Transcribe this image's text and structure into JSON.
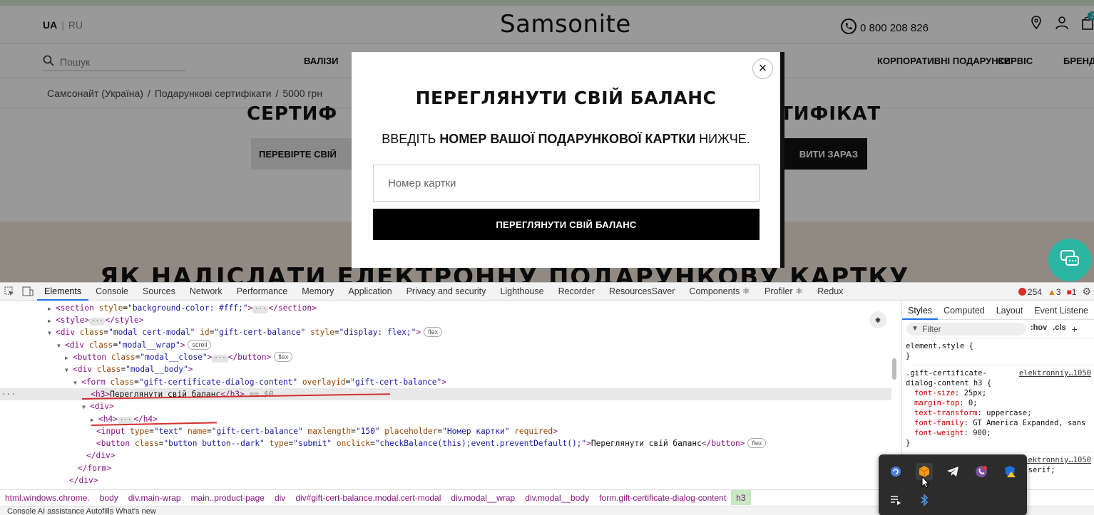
{
  "site": {
    "lang": {
      "ua": "UA",
      "ru": "RU"
    },
    "logo": "Samsonite",
    "phone": "0 800 208 826",
    "cart_count": "3",
    "search_placeholder": "Пошук",
    "nav": {
      "luggage": "ВАЛІЗИ",
      "corporate": "КОРПОРАТИВНІ ПОДАРУНКИ",
      "service": "СЕРВІС",
      "brands": "БРЕНД"
    },
    "breadcrumbs": [
      "Самсонайт (Україна)",
      "Подарункові сертифікати",
      "5000 грн"
    ],
    "title_left": "СЕРТИФ",
    "title_right": "ТИФІКАТ",
    "check_button": "ПЕРЕВІРТЕ СВІЙ",
    "buy_button": "ВИТИ ЗАРАЗ",
    "how_to_title": "ЯК НАДІСЛАТИ ЕЛЕКТРОННУ ПОДАРУНКОВУ КАРТКУ"
  },
  "modal": {
    "close": "×",
    "title": "Переглянути свій баланс",
    "sub_prefix": "ВВЕДІТЬ ",
    "sub_bold": "НОМЕР ВАШОЇ ПОДАРУНКОВОЇ КАРТКИ",
    "sub_suffix": " НИЖЧЕ.",
    "input_placeholder": "Номер картки",
    "submit": "ПЕРЕГЛЯНУТИ СВІЙ БАЛАНС"
  },
  "devtools": {
    "tabs": [
      "Elements",
      "Console",
      "Sources",
      "Network",
      "Performance",
      "Memory",
      "Application",
      "Privacy and security",
      "Lighthouse",
      "Recorder",
      "ResourcesSaver",
      "Components ⚛",
      "Profiler ⚛",
      "Redux"
    ],
    "errors": "254",
    "warnings": "3",
    "issues": "1",
    "styles_tabs": [
      "Styles",
      "Computed",
      "Layout",
      "Event Listene"
    ],
    "filter_placeholder": "Filter",
    "filter_ops": [
      ":hov",
      ".cls",
      "+"
    ],
    "css": {
      "element_style": "element.style {",
      "close_brace": "}",
      "selector1": ".gift-certificate-",
      "selector2": "dialog-content h3 {",
      "link": "elektronniy…1050",
      "props": [
        {
          "p": "font-size",
          "v": "25px;"
        },
        {
          "p": "margin-top",
          "v": "0;"
        },
        {
          "p": "text-transform",
          "v": "uppercase;"
        },
        {
          "p": "font-family",
          "v": "GT America Expanded, sans"
        },
        {
          "p": "font-weight",
          "v": "900;"
        }
      ],
      "link2": "elektronniy…1050",
      "tail": ", sans-serif;"
    },
    "breadcrumbs": [
      "html.windows.chrome.",
      "body",
      "div.main-wrap",
      "main..product-page",
      "div",
      "div#gift-cert-balance.modal.cert-modal",
      "div.modal__wrap",
      "div.modal__body",
      "form.gift-certificate-dialog-content",
      "h3"
    ],
    "drawer": "Console   AI assistance   Autofills   What's new"
  }
}
